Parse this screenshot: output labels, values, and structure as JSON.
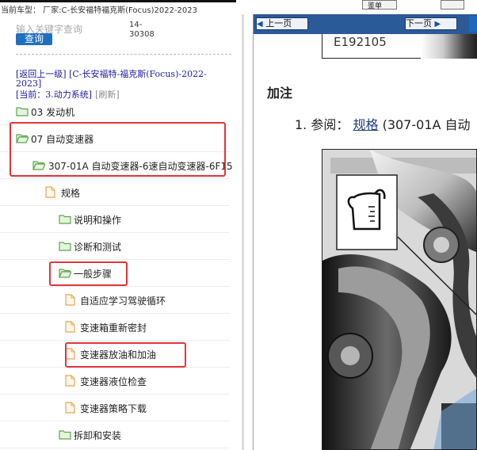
{
  "header": {
    "vehicle_info": "当前车型：  厂家:C-长安福特福克斯(Focus)2022-2023",
    "button_label": "鉴单"
  },
  "sidebar": {
    "search_placeholder": "输入关键字查询",
    "doc_code": "14-30308",
    "search_button": "查询",
    "breadcrumb_back": "[返回上一级]",
    "breadcrumb_path": "[C-长安福特-福克斯(Focus)-2022-2023]",
    "current_prefix": "[当前：",
    "current_section": "3.动力系统",
    "current_suffix": "]",
    "refresh": "[刷新]",
    "tree": [
      {
        "label": "03 发动机",
        "type": "folder"
      },
      {
        "label": "07 自动变速器",
        "type": "folder-open"
      },
      {
        "label": "307-01A 自动变速器-6速自动变速器-6F15",
        "type": "folder-open"
      },
      {
        "label": "规格",
        "type": "doc"
      },
      {
        "label": "说明和操作",
        "type": "folder"
      },
      {
        "label": "诊断和测试",
        "type": "folder"
      },
      {
        "label": "一般步骤",
        "type": "folder-open"
      },
      {
        "label": "自适应学习驾驶循环",
        "type": "doc"
      },
      {
        "label": "变速箱重新密封",
        "type": "doc"
      },
      {
        "label": "变速器放油和加油",
        "type": "doc"
      },
      {
        "label": "变速器液位检查",
        "type": "doc"
      },
      {
        "label": "变速器策略下载",
        "type": "doc"
      },
      {
        "label": "拆卸和安装",
        "type": "folder"
      }
    ]
  },
  "viewer": {
    "prev_page": "上一页",
    "next_page": "下一页",
    "figure_code": "E192105",
    "heading": "加注",
    "step_number": "1.",
    "step_prefix": "参阅：",
    "step_link": "规格",
    "step_suffix": "(307-01A 自动"
  },
  "colors": {
    "highlight_border": "#e0353a",
    "nav_bar": "#2a5a98",
    "search_button": "#1f6fbf",
    "folder_green": "#5aa84a",
    "doc_orange": "#e8a552"
  }
}
